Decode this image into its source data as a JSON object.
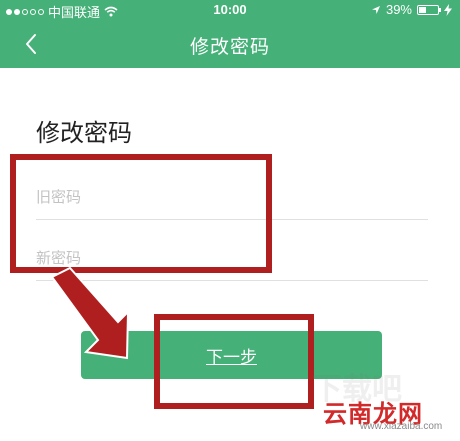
{
  "status_bar": {
    "carrier": "中国联通",
    "time": "10:00",
    "battery": "39%",
    "battery_level": 0.39,
    "signal_dots": [
      true,
      true,
      false,
      false,
      false
    ],
    "icons": [
      "wifi-icon",
      "location-arrow-icon",
      "charging-icon"
    ]
  },
  "nav": {
    "title": "修改密码",
    "back_icon": "chevron-left-icon"
  },
  "form": {
    "heading": "修改密码",
    "old_password_placeholder": "旧密码",
    "new_password_placeholder": "新密码",
    "next_label": "下一步"
  },
  "watermark": {
    "site": "云南龙网",
    "url": "www.xiazaiba.com"
  },
  "colors": {
    "brand_green": "#45b078",
    "annotation_red": "#b01f1f"
  }
}
